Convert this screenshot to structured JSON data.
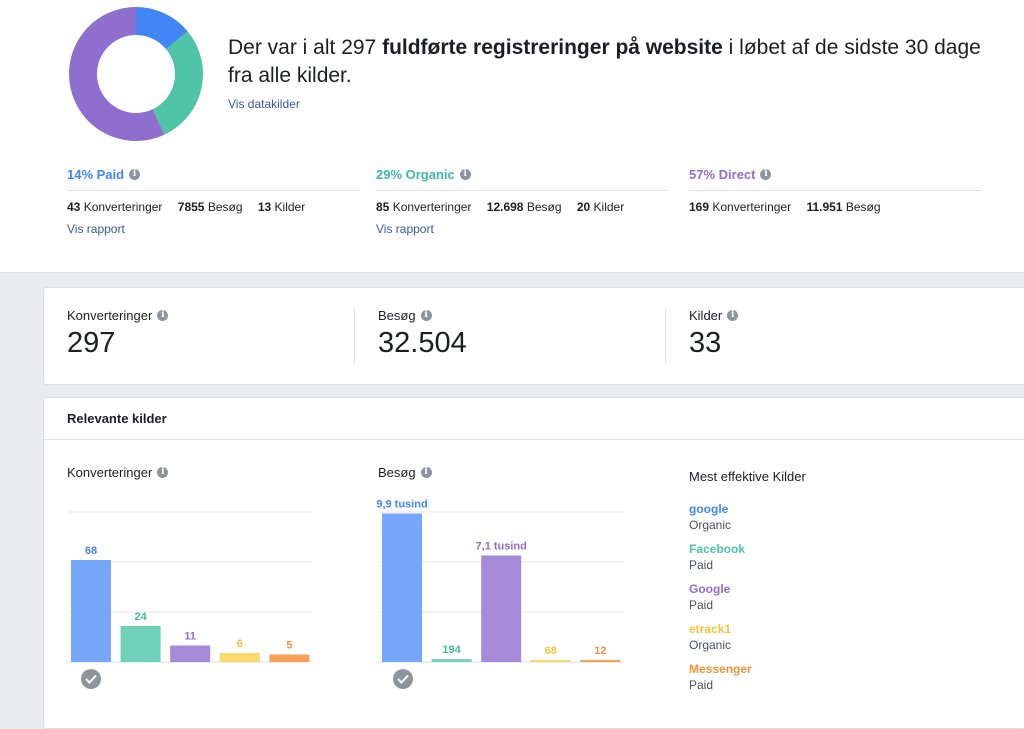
{
  "colors": {
    "blue": "#4285f4",
    "teal": "#4fc4a7",
    "purple": "#8e6fce",
    "yellow": "#f7cb4d",
    "orange": "#f0913a",
    "link": "#365899"
  },
  "summary": {
    "text_pre": "Der var i alt 297 ",
    "text_bold": "fuldførte registreringer på website",
    "text_post": " i løbet af de sidste 30 dage fra alle kilder.",
    "link": "Vis datakilder",
    "donut": [
      {
        "name": "Paid",
        "value": 14,
        "color": "#4285f4"
      },
      {
        "name": "Organic",
        "value": 29,
        "color": "#4fc4a7"
      },
      {
        "name": "Direct",
        "value": 57,
        "color": "#8e6fce"
      }
    ]
  },
  "segments": [
    {
      "title": "14% Paid",
      "color": "#4285f4",
      "conversions": "43",
      "conversions_label": "Konverteringer",
      "visits": "7855",
      "visits_label": "Besøg",
      "sources": "13",
      "sources_label": "Kilder",
      "link": "Vis rapport"
    },
    {
      "title": "29% Organic",
      "color": "#3fb99b",
      "conversions": "85",
      "conversions_label": "Konverteringer",
      "visits": "12.698",
      "visits_label": "Besøg",
      "sources": "20",
      "sources_label": "Kilder",
      "link": "Vis rapport"
    },
    {
      "title": "57% Direct",
      "color": "#8e6fce",
      "conversions": "169",
      "conversions_label": "Konverteringer",
      "visits": "11.951",
      "visits_label": "Besøg"
    }
  ],
  "kpis": [
    {
      "label": "Konverteringer",
      "value": "297"
    },
    {
      "label": "Besøg",
      "value": "32.504"
    },
    {
      "label": "Kilder",
      "value": "33"
    }
  ],
  "relevant": {
    "header": "Relevante kilder",
    "conv_title": "Konverteringer",
    "visit_title": "Besøg",
    "best_title": "Mest effektive Kilder",
    "sources": [
      {
        "name": "google",
        "type": "Organic",
        "color": "#4285f4"
      },
      {
        "name": "Facebook",
        "type": "Paid",
        "color": "#4fc4a7"
      },
      {
        "name": "Google",
        "type": "Paid",
        "color": "#8e6fce"
      },
      {
        "name": "etrack1",
        "type": "Organic",
        "color": "#f5c33b"
      },
      {
        "name": "Messenger",
        "type": "Paid",
        "color": "#f0913a"
      }
    ]
  },
  "chart_data": [
    {
      "type": "bar",
      "title": "Konverteringer",
      "categories": [
        "google",
        "Facebook",
        "Google",
        "etrack1",
        "Messenger"
      ],
      "values": [
        68,
        24,
        11,
        6,
        5
      ],
      "labels": [
        "68",
        "24",
        "11",
        "6",
        "5"
      ],
      "colors": [
        "#76a7fa",
        "#6fd1b8",
        "#a48ad8",
        "#fbd96b",
        "#f5a15a"
      ],
      "label_colors": [
        "#4285f4",
        "#3fb99b",
        "#8e6fce",
        "#f5c33b",
        "#f0913a"
      ],
      "ylim": [
        0,
        100
      ],
      "grid": true
    },
    {
      "type": "bar",
      "title": "Besøg",
      "categories": [
        "google",
        "Facebook",
        "Google",
        "etrack1",
        "Messenger"
      ],
      "values": [
        9900,
        194,
        7100,
        68,
        12
      ],
      "labels": [
        "9,9 tusind",
        "194",
        "7,1 tusind",
        "68",
        "12"
      ],
      "colors": [
        "#76a7fa",
        "#6fd1b8",
        "#a48ad8",
        "#fbd96b",
        "#f5a15a"
      ],
      "label_colors": [
        "#4285f4",
        "#3fb99b",
        "#8e6fce",
        "#f5c33b",
        "#f0913a"
      ],
      "ylim": [
        0,
        10000
      ],
      "grid": true
    }
  ]
}
